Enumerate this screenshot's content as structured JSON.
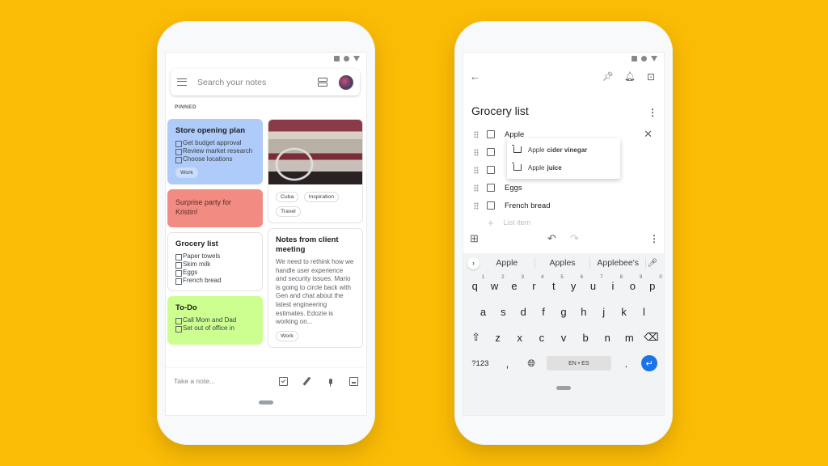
{
  "status_icons": [
    "square-icon",
    "circle-icon",
    "wifi-triangle-icon"
  ],
  "left_phone": {
    "search_placeholder": "Search your notes",
    "section_label": "PINNED",
    "cards_col_a": [
      {
        "title": "Store opening plan",
        "color": "#aecbfa",
        "items": [
          "Get budget approval",
          "Review market research",
          "Choose locations"
        ],
        "labels": [
          "Work"
        ]
      },
      {
        "title": "Surprise party for Kristin!",
        "color": "#f28b82"
      },
      {
        "title": "Grocery list",
        "color": "#ffffff",
        "items": [
          "Paper towels",
          "Skim milk",
          "Eggs",
          "French bread"
        ]
      },
      {
        "title": "To-Do",
        "color": "#ccff90",
        "items": [
          "Call Mom and Dad",
          "Set out of office in"
        ]
      }
    ],
    "cards_col_b": [
      {
        "image": "vintage-car-interior",
        "labels": [
          "Cuba",
          "Inspiration",
          "Travel"
        ]
      },
      {
        "title": "Notes from client meeting",
        "body": "We need to rethink how we handle user experience and security issues. Mario is going to circle back with Gen and chat about the latest engineering estimates. Edozie is working on...",
        "labels": [
          "Work"
        ]
      }
    ],
    "bottom_bar": {
      "placeholder": "Take a note...",
      "icons": [
        "checkbox-icon",
        "brush-icon",
        "mic-icon",
        "image-icon"
      ]
    }
  },
  "right_phone": {
    "toolbar_icons": [
      "back-arrow-icon",
      "pin-icon",
      "reminder-bell-icon",
      "archive-icon"
    ],
    "note_title": "Grocery list",
    "list_items": [
      {
        "text": "Apple",
        "checked": false
      },
      {
        "text": "",
        "checked": false
      },
      {
        "text": "",
        "checked": false
      },
      {
        "text": "Eggs",
        "checked": false
      },
      {
        "text": "French bread",
        "checked": false
      }
    ],
    "add_item_placeholder": "List item",
    "suggestions_popup": [
      {
        "prefix": "Apple",
        "bold": "cider vinegar"
      },
      {
        "prefix": "Apple",
        "bold": "juice"
      }
    ],
    "editor_toolbar": {
      "add": "+",
      "undo": "↶",
      "redo": "↷",
      "more": "⋮"
    },
    "keyboard": {
      "suggestions": [
        "Apple",
        "Apples",
        "Applebee's"
      ],
      "row1": [
        "q",
        "w",
        "e",
        "r",
        "t",
        "y",
        "u",
        "i",
        "o",
        "p"
      ],
      "row1_hints": [
        "1",
        "2",
        "3",
        "4",
        "5",
        "6",
        "7",
        "8",
        "9",
        "0"
      ],
      "row2": [
        "a",
        "s",
        "d",
        "f",
        "g",
        "h",
        "j",
        "k",
        "l"
      ],
      "row3": [
        "z",
        "x",
        "c",
        "v",
        "b",
        "n",
        "m"
      ],
      "symbols_key": "?123",
      "comma_key": ",",
      "space_label": "EN • ES",
      "period_key": "."
    }
  }
}
